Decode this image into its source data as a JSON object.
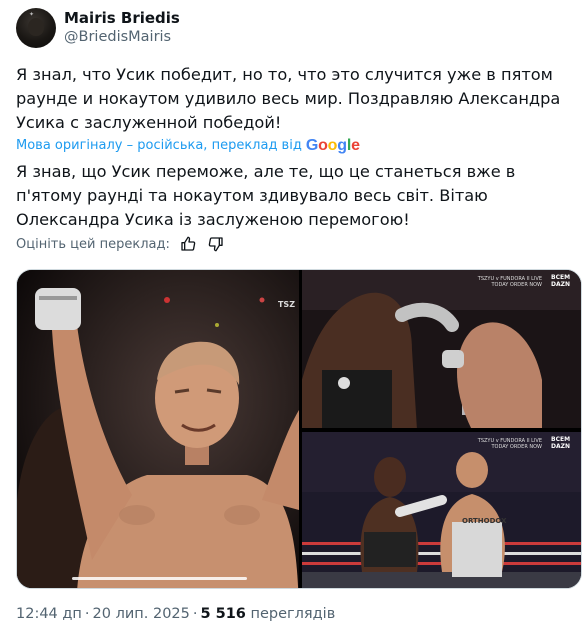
{
  "author": {
    "display_name": "Mairis Briedis",
    "handle": "@BriedisMairis"
  },
  "tweet": {
    "original_text": "Я знал, что Усик победит, но то, что это случится уже в пятом раунде и нокаутом удивило весь мир. Поздравляю Александра Усика с заслуженной победой!",
    "translation_note": "Мова оригіналу – російська, переклад від",
    "translation_provider": "Google",
    "translated_text": "Я знав, що Усик переможе, але те, що це станеться вже в п'ятому раунді та нокаутом здивувало весь світ. Вітаю Олександра Усика із заслуженою перемогою!",
    "rate_label": "Оцініть цей переклад:"
  },
  "media": {
    "overlay_top": "TSZYU v FUNDORA II  LIVE TODAY ORDER NOW",
    "overlay_bot": "TSZYU v FUNDORA II  LIVE TODAY ORDER NOW",
    "badge": "ВСЕМ DAZN",
    "trunks_text": "ORTHODOX",
    "corner_text": "TSZ"
  },
  "footer": {
    "time": "12:44 дп",
    "date": "20 лип. 2025",
    "views_count": "5 516",
    "views_label": "переглядів"
  },
  "colors": {
    "accent": "#1d9bf0",
    "secondary_text": "#536471",
    "primary_text": "#0f1419"
  }
}
